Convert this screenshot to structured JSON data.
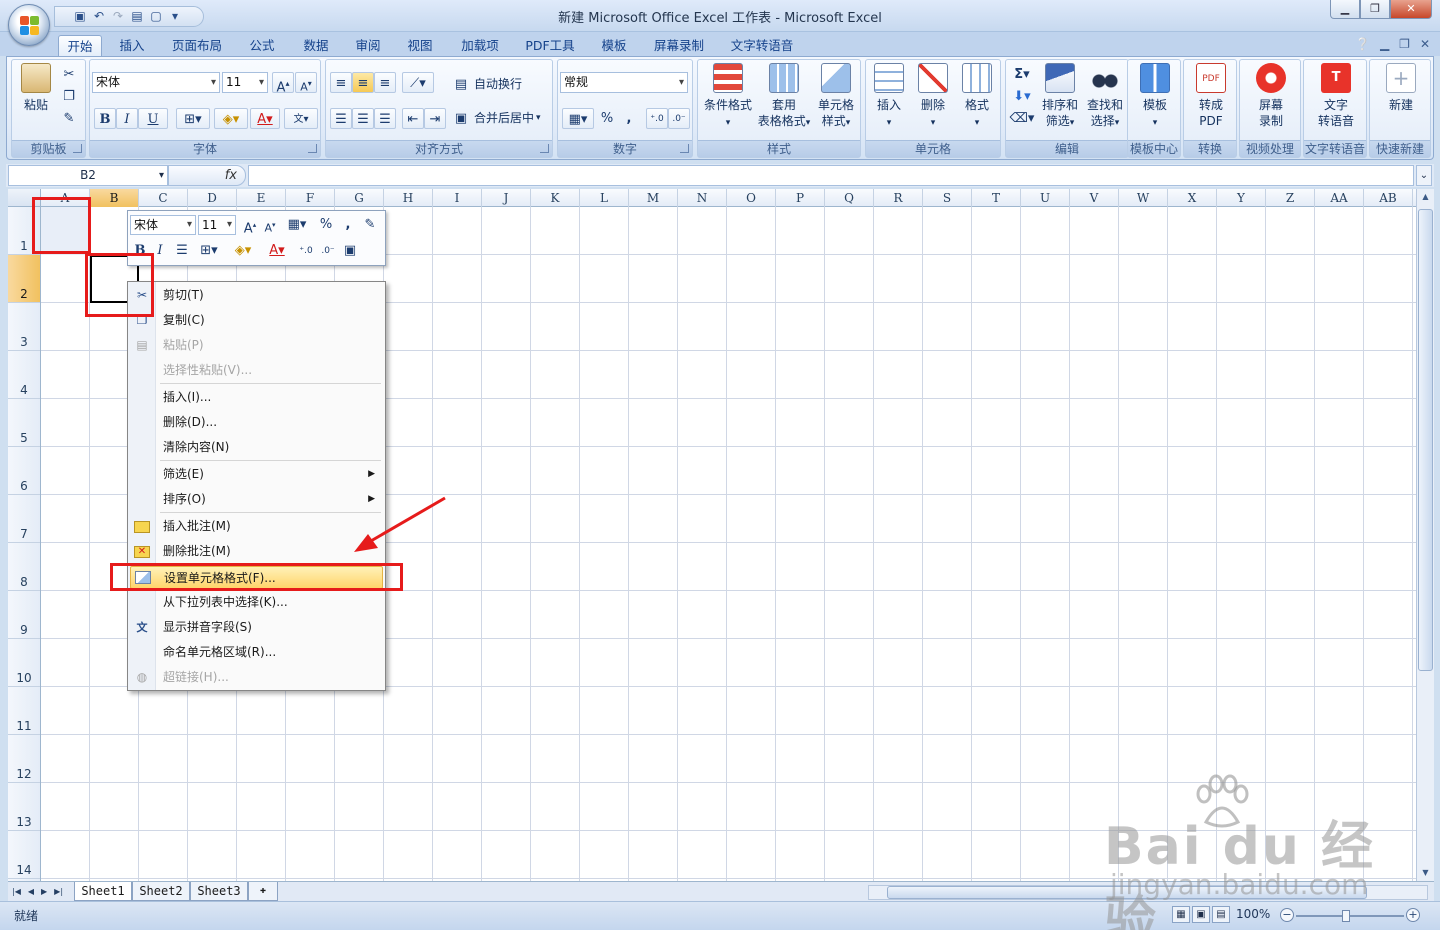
{
  "window": {
    "title": "新建 Microsoft Office Excel 工作表 - Microsoft Excel",
    "controls": [
      "▁",
      "❐",
      "✕"
    ]
  },
  "tabs": [
    "开始",
    "插入",
    "页面布局",
    "公式",
    "数据",
    "审阅",
    "视图",
    "加载项",
    "PDF工具",
    "模板",
    "屏幕录制",
    "文字转语音"
  ],
  "ribbon": {
    "clipboard": {
      "paste": "粘贴",
      "label": "剪贴板"
    },
    "font": {
      "name": "宋体",
      "size": "11",
      "label": "字体",
      "bold": "B",
      "italic": "I",
      "underline": "U"
    },
    "alignment": {
      "wrap": "自动换行",
      "merge": "合并后居中",
      "label": "对齐方式"
    },
    "number": {
      "format": "常规",
      "percent": "%",
      "comma": ",",
      "label": "数字"
    },
    "styles": {
      "conditional": "条件格式",
      "table_line1": "套用",
      "table_line2": "表格格式",
      "cell_line1": "单元格",
      "cell_line2": "样式",
      "label": "样式"
    },
    "cells": {
      "insert": "插入",
      "delete": "删除",
      "format": "格式",
      "label": "单元格"
    },
    "editing": {
      "sort_line1": "排序和",
      "sort_line2": "筛选",
      "find_line1": "查找和",
      "find_line2": "选择",
      "label": "编辑"
    },
    "template": {
      "btn": "模板",
      "label": "模板中心"
    },
    "pdf": {
      "line1": "转成",
      "line2": "PDF",
      "label": "转换"
    },
    "record": {
      "line1": "屏幕",
      "line2": "录制",
      "label": "视频处理"
    },
    "tts": {
      "line1": "文字",
      "line2": "转语音",
      "label": "文字转语音"
    },
    "newdoc": {
      "btn": "新建",
      "label": "快速新建"
    }
  },
  "formula_bar": {
    "name_box": "B2",
    "fx": "fx"
  },
  "columns": [
    "A",
    "B",
    "C",
    "D",
    "E",
    "F",
    "G",
    "H",
    "I",
    "J",
    "K",
    "L",
    "M",
    "N",
    "O",
    "P",
    "Q",
    "R",
    "S",
    "T",
    "U",
    "V",
    "W",
    "X",
    "Y",
    "Z",
    "AA",
    "AB"
  ],
  "rows": [
    "1",
    "2",
    "3",
    "4",
    "5",
    "6",
    "7",
    "8",
    "9",
    "10",
    "11",
    "12",
    "13",
    "14"
  ],
  "mini_toolbar": {
    "font": "宋体",
    "size": "11",
    "bold": "B",
    "italic": "I",
    "percent": "%",
    "comma": ","
  },
  "context_menu": {
    "cut": "剪切(T)",
    "copy": "复制(C)",
    "paste": "粘贴(P)",
    "paste_special": "选择性粘贴(V)...",
    "insert": "插入(I)...",
    "delete": "删除(D)...",
    "clear": "清除内容(N)",
    "filter": "筛选(E)",
    "sort": "排序(O)",
    "insert_comment": "插入批注(M)",
    "delete_comment": "删除批注(M)",
    "format_cells": "设置单元格格式(F)...",
    "pick_list": "从下拉列表中选择(K)...",
    "phonetic": "显示拼音字段(S)",
    "name_range": "命名单元格区域(R)...",
    "hyperlink": "超链接(H)..."
  },
  "sheet_tabs": [
    "Sheet1",
    "Sheet2",
    "Sheet3"
  ],
  "status": {
    "ready": "就绪",
    "zoom": "100%"
  },
  "watermark": {
    "brand": "Bai  du 经验",
    "url": "jingyan.baidu.com"
  },
  "colors": {
    "highlight": "#ffd56b",
    "annotation": "#e61b1b",
    "selected_header": "#f1c15f"
  }
}
